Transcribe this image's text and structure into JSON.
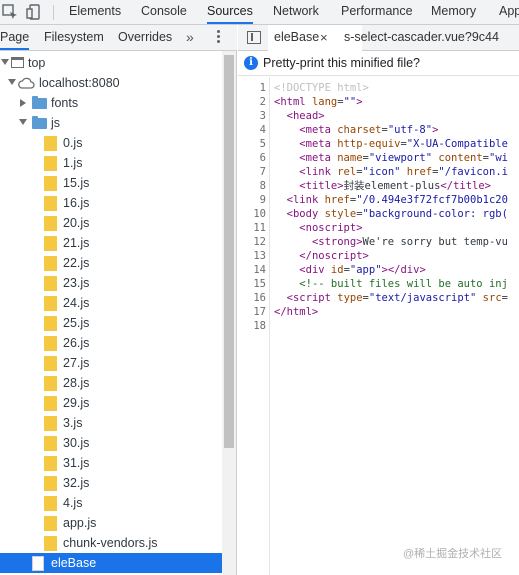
{
  "toolbar": {
    "tabs": [
      {
        "label": "Elements"
      },
      {
        "label": "Console"
      },
      {
        "label": "Sources"
      },
      {
        "label": "Network"
      },
      {
        "label": "Performance"
      },
      {
        "label": "Memory"
      },
      {
        "label": "App"
      }
    ],
    "active_tab": "Sources"
  },
  "navigator": {
    "tabs": [
      {
        "label": "Page"
      },
      {
        "label": "Filesystem"
      },
      {
        "label": "Overrides"
      }
    ],
    "more_label": "»"
  },
  "tree": {
    "top_label": "top",
    "host_label": "localhost:8080",
    "fonts_label": "fonts",
    "js_label": "js",
    "files": [
      "0.js",
      "1.js",
      "15.js",
      "16.js",
      "20.js",
      "21.js",
      "22.js",
      "23.js",
      "24.js",
      "25.js",
      "26.js",
      "27.js",
      "28.js",
      "29.js",
      "3.js",
      "30.js",
      "31.js",
      "32.js",
      "4.js",
      "app.js",
      "chunk-vendors.js"
    ],
    "selected_label": "eleBase"
  },
  "editor": {
    "tabs": [
      {
        "label": "eleBase",
        "close": "×"
      },
      {
        "label": "s-select-cascader.vue?9c44"
      }
    ],
    "info_message": "Pretty-print this minified file?",
    "line_numbers": [
      "1",
      "2",
      "3",
      "4",
      "5",
      "6",
      "7",
      "8",
      "9",
      "10",
      "11",
      "12",
      "13",
      "14",
      "15",
      "16",
      "17",
      "18"
    ]
  },
  "watermark": "@稀土掘金技术社区",
  "colors": {
    "accent": "#1a73e8",
    "js_file": "#f5c842",
    "folder": "#5a9bd4"
  }
}
